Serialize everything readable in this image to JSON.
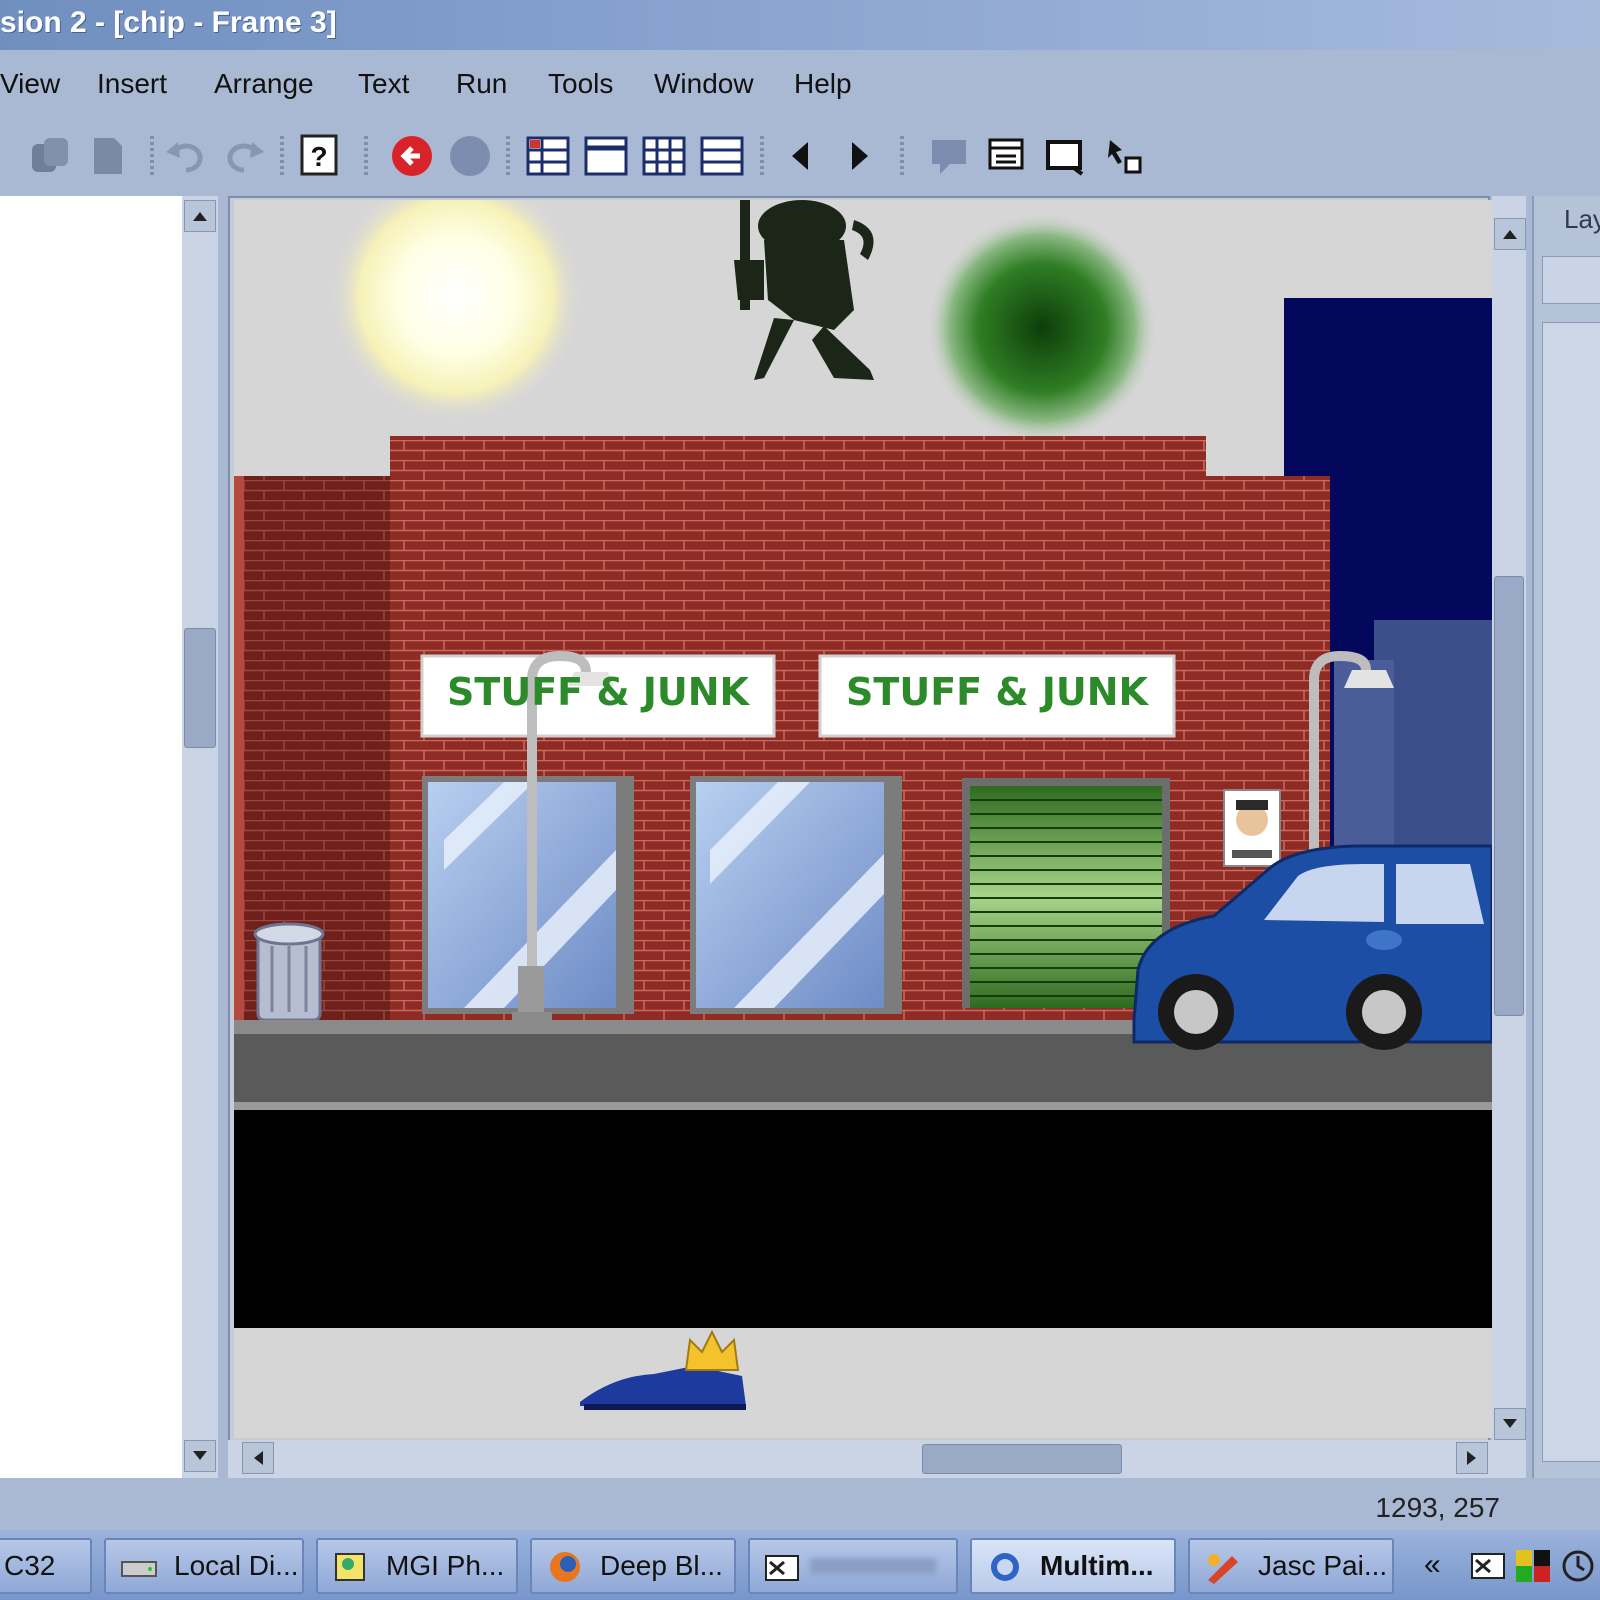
{
  "window": {
    "title": "sion 2 - [chip - Frame 3]"
  },
  "menu": {
    "items": [
      {
        "id": "view",
        "label": "View"
      },
      {
        "id": "insert",
        "label": "Insert"
      },
      {
        "id": "arrange",
        "label": "Arrange"
      },
      {
        "id": "text",
        "label": "Text"
      },
      {
        "id": "run",
        "label": "Run"
      },
      {
        "id": "tools",
        "label": "Tools"
      },
      {
        "id": "window",
        "label": "Window"
      },
      {
        "id": "help",
        "label": "Help"
      }
    ]
  },
  "toolbar": {
    "icons": [
      "copy-icon",
      "paste-icon",
      "undo-icon",
      "redo-icon",
      "help-icon",
      "stop-icon",
      "record-icon",
      "table-view-icon",
      "frame-view-icon",
      "grid-view-icon",
      "list-view-icon",
      "previous-icon",
      "next-icon",
      "comment-icon",
      "frame-list-icon",
      "screen-icon",
      "cursor-tool-icon"
    ]
  },
  "stage": {
    "signs": [
      {
        "text": "STUFF & JUNK"
      },
      {
        "text": "STUFF & JUNK"
      }
    ],
    "colors": {
      "sky": "#d6d6d6",
      "brick": "#8e2b24",
      "night": "#04085c",
      "sidewalk": "#5a5a5a",
      "car": "#1c4ea6"
    }
  },
  "panels": {
    "layers_label": "Lay"
  },
  "status": {
    "coords": "1293, 257"
  },
  "taskbar": {
    "tasks": [
      {
        "label": "C32",
        "icon": "app-icon"
      },
      {
        "label": "Local Di...",
        "icon": "drive-icon"
      },
      {
        "label": "MGI Ph...",
        "icon": "photo-icon"
      },
      {
        "label": "Deep Bl...",
        "icon": "browser-icon"
      },
      {
        "label": "",
        "icon": "window-icon"
      },
      {
        "label": "Multim...",
        "icon": "multimedia-icon"
      },
      {
        "label": "Jasc Pai...",
        "icon": "paint-icon"
      }
    ],
    "tray_chevron": "«"
  }
}
